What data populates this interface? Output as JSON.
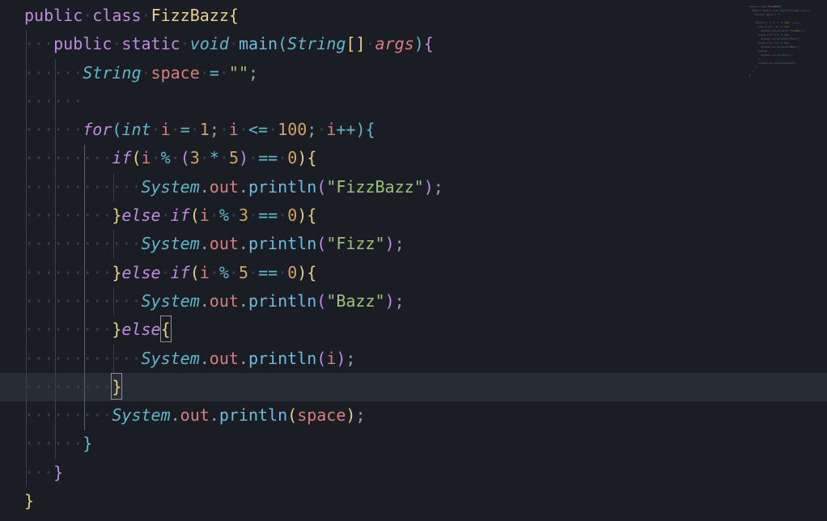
{
  "language": "java",
  "colors": {
    "background": "#1a1d23",
    "current_line": "#282c34",
    "keyword": "#c08be0",
    "type": "#5fb7c9",
    "class": "#e6cf8b",
    "function": "#6fbcde",
    "variable": "#d97e7e",
    "number": "#d0a36a",
    "string": "#9bc47a",
    "operator": "#5fb7c9",
    "punct": "#9aa0ac",
    "whitespace_marker": "#3b3f48"
  },
  "editor": {
    "cursor_line_index": 13,
    "lines": [
      {
        "indent": 0,
        "tokens": [
          {
            "t": "public",
            "c": "kw"
          },
          {
            "t": " ",
            "c": "ws"
          },
          {
            "t": "class",
            "c": "kw"
          },
          {
            "t": " ",
            "c": "ws"
          },
          {
            "t": "FizzBazz",
            "c": "cls"
          },
          {
            "t": "{",
            "c": "brace1"
          }
        ]
      },
      {
        "indent": 1,
        "tokens": [
          {
            "t": "public",
            "c": "kw"
          },
          {
            "t": " ",
            "c": "ws"
          },
          {
            "t": "static",
            "c": "kw"
          },
          {
            "t": " ",
            "c": "ws"
          },
          {
            "t": "void",
            "c": "type"
          },
          {
            "t": " ",
            "c": "ws"
          },
          {
            "t": "main",
            "c": "fn"
          },
          {
            "t": "(",
            "c": "brace3"
          },
          {
            "t": "String",
            "c": "type"
          },
          {
            "t": "[]",
            "c": "brk"
          },
          {
            "t": " ",
            "c": "ws"
          },
          {
            "t": "args",
            "c": "varit"
          },
          {
            "t": ")",
            "c": "brace3"
          },
          {
            "t": "{",
            "c": "brace2"
          }
        ]
      },
      {
        "indent": 2,
        "tokens": [
          {
            "t": "String",
            "c": "type"
          },
          {
            "t": " ",
            "c": "ws"
          },
          {
            "t": "space",
            "c": "var"
          },
          {
            "t": " ",
            "c": "ws"
          },
          {
            "t": "=",
            "c": "op"
          },
          {
            "t": " ",
            "c": "ws"
          },
          {
            "t": "\"\"",
            "c": "str"
          },
          {
            "t": ";",
            "c": "pun"
          }
        ]
      },
      {
        "indent": 2,
        "tokens": []
      },
      {
        "indent": 2,
        "tokens": [
          {
            "t": "for",
            "c": "kw2"
          },
          {
            "t": "(",
            "c": "brace3"
          },
          {
            "t": "int",
            "c": "type"
          },
          {
            "t": " ",
            "c": "ws"
          },
          {
            "t": "i",
            "c": "var"
          },
          {
            "t": " ",
            "c": "ws"
          },
          {
            "t": "=",
            "c": "op"
          },
          {
            "t": " ",
            "c": "ws"
          },
          {
            "t": "1",
            "c": "num"
          },
          {
            "t": ";",
            "c": "pun"
          },
          {
            "t": " ",
            "c": "ws"
          },
          {
            "t": "i",
            "c": "var"
          },
          {
            "t": " ",
            "c": "ws"
          },
          {
            "t": "<=",
            "c": "op"
          },
          {
            "t": " ",
            "c": "ws"
          },
          {
            "t": "100",
            "c": "num"
          },
          {
            "t": ";",
            "c": "pun"
          },
          {
            "t": " ",
            "c": "ws"
          },
          {
            "t": "i",
            "c": "var"
          },
          {
            "t": "++",
            "c": "op"
          },
          {
            "t": ")",
            "c": "brace3"
          },
          {
            "t": "{",
            "c": "brace3"
          }
        ]
      },
      {
        "indent": 3,
        "tokens": [
          {
            "t": "if",
            "c": "kw2"
          },
          {
            "t": "(",
            "c": "brace4"
          },
          {
            "t": "i",
            "c": "var"
          },
          {
            "t": " ",
            "c": "ws"
          },
          {
            "t": "%",
            "c": "op"
          },
          {
            "t": " ",
            "c": "ws"
          },
          {
            "t": "(",
            "c": "brace5"
          },
          {
            "t": "3",
            "c": "num"
          },
          {
            "t": " ",
            "c": "ws"
          },
          {
            "t": "*",
            "c": "op"
          },
          {
            "t": " ",
            "c": "ws"
          },
          {
            "t": "5",
            "c": "num"
          },
          {
            "t": ")",
            "c": "brace5"
          },
          {
            "t": " ",
            "c": "ws"
          },
          {
            "t": "==",
            "c": "op"
          },
          {
            "t": " ",
            "c": "ws"
          },
          {
            "t": "0",
            "c": "num"
          },
          {
            "t": ")",
            "c": "brace4"
          },
          {
            "t": "{",
            "c": "brace4"
          }
        ]
      },
      {
        "indent": 4,
        "tokens": [
          {
            "t": "System",
            "c": "type"
          },
          {
            "t": ".",
            "c": "pun"
          },
          {
            "t": "out",
            "c": "var"
          },
          {
            "t": ".",
            "c": "pun"
          },
          {
            "t": "println",
            "c": "fn"
          },
          {
            "t": "(",
            "c": "brace5"
          },
          {
            "t": "\"FizzBazz\"",
            "c": "str"
          },
          {
            "t": ")",
            "c": "brace5"
          },
          {
            "t": ";",
            "c": "pun"
          }
        ]
      },
      {
        "indent": 3,
        "tokens": [
          {
            "t": "}",
            "c": "brace4"
          },
          {
            "t": "else",
            "c": "kw2"
          },
          {
            "t": " ",
            "c": "ws"
          },
          {
            "t": "if",
            "c": "kw2"
          },
          {
            "t": "(",
            "c": "brace4"
          },
          {
            "t": "i",
            "c": "var"
          },
          {
            "t": " ",
            "c": "ws"
          },
          {
            "t": "%",
            "c": "op"
          },
          {
            "t": " ",
            "c": "ws"
          },
          {
            "t": "3",
            "c": "num"
          },
          {
            "t": " ",
            "c": "ws"
          },
          {
            "t": "==",
            "c": "op"
          },
          {
            "t": " ",
            "c": "ws"
          },
          {
            "t": "0",
            "c": "num"
          },
          {
            "t": ")",
            "c": "brace4"
          },
          {
            "t": "{",
            "c": "brace4"
          }
        ]
      },
      {
        "indent": 4,
        "tokens": [
          {
            "t": "System",
            "c": "type"
          },
          {
            "t": ".",
            "c": "pun"
          },
          {
            "t": "out",
            "c": "var"
          },
          {
            "t": ".",
            "c": "pun"
          },
          {
            "t": "println",
            "c": "fn"
          },
          {
            "t": "(",
            "c": "brace5"
          },
          {
            "t": "\"Fizz\"",
            "c": "str"
          },
          {
            "t": ")",
            "c": "brace5"
          },
          {
            "t": ";",
            "c": "pun"
          }
        ]
      },
      {
        "indent": 3,
        "tokens": [
          {
            "t": "}",
            "c": "brace4"
          },
          {
            "t": "else",
            "c": "kw2"
          },
          {
            "t": " ",
            "c": "ws"
          },
          {
            "t": "if",
            "c": "kw2"
          },
          {
            "t": "(",
            "c": "brace4"
          },
          {
            "t": "i",
            "c": "var"
          },
          {
            "t": " ",
            "c": "ws"
          },
          {
            "t": "%",
            "c": "op"
          },
          {
            "t": " ",
            "c": "ws"
          },
          {
            "t": "5",
            "c": "num"
          },
          {
            "t": " ",
            "c": "ws"
          },
          {
            "t": "==",
            "c": "op"
          },
          {
            "t": " ",
            "c": "ws"
          },
          {
            "t": "0",
            "c": "num"
          },
          {
            "t": ")",
            "c": "brace4"
          },
          {
            "t": "{",
            "c": "brace4"
          }
        ]
      },
      {
        "indent": 4,
        "tokens": [
          {
            "t": "System",
            "c": "type"
          },
          {
            "t": ".",
            "c": "pun"
          },
          {
            "t": "out",
            "c": "var"
          },
          {
            "t": ".",
            "c": "pun"
          },
          {
            "t": "println",
            "c": "fn"
          },
          {
            "t": "(",
            "c": "brace5"
          },
          {
            "t": "\"Bazz\"",
            "c": "str"
          },
          {
            "t": ")",
            "c": "brace5"
          },
          {
            "t": ";",
            "c": "pun"
          }
        ]
      },
      {
        "indent": 3,
        "tokens": [
          {
            "t": "}",
            "c": "brace4"
          },
          {
            "t": "else",
            "c": "kw2"
          },
          {
            "t": "{",
            "c": "brace4",
            "box": true
          }
        ]
      },
      {
        "indent": 4,
        "tokens": [
          {
            "t": "System",
            "c": "type"
          },
          {
            "t": ".",
            "c": "pun"
          },
          {
            "t": "out",
            "c": "var"
          },
          {
            "t": ".",
            "c": "pun"
          },
          {
            "t": "println",
            "c": "fn"
          },
          {
            "t": "(",
            "c": "brace5"
          },
          {
            "t": "i",
            "c": "var"
          },
          {
            "t": ")",
            "c": "brace5"
          },
          {
            "t": ";",
            "c": "pun"
          }
        ]
      },
      {
        "indent": 3,
        "tokens": [
          {
            "t": "}",
            "c": "brace4",
            "box": true
          }
        ]
      },
      {
        "indent": 3,
        "tokens": [
          {
            "t": "System",
            "c": "type"
          },
          {
            "t": ".",
            "c": "pun"
          },
          {
            "t": "out",
            "c": "var"
          },
          {
            "t": ".",
            "c": "pun"
          },
          {
            "t": "println",
            "c": "fn"
          },
          {
            "t": "(",
            "c": "brace4"
          },
          {
            "t": "space",
            "c": "var"
          },
          {
            "t": ")",
            "c": "brace4"
          },
          {
            "t": ";",
            "c": "pun"
          }
        ]
      },
      {
        "indent": 2,
        "tokens": [
          {
            "t": "}",
            "c": "brace3"
          }
        ]
      },
      {
        "indent": 1,
        "tokens": [
          {
            "t": "}",
            "c": "brace2"
          }
        ]
      },
      {
        "indent": 0,
        "tokens": [
          {
            "t": "}",
            "c": "brace1"
          }
        ]
      }
    ],
    "guides": [
      {
        "col": 1,
        "from": 1,
        "to": 16
      },
      {
        "col": 2,
        "from": 2,
        "to": 15
      },
      {
        "col": 3,
        "from": 5,
        "to": 14,
        "active": true
      },
      {
        "col": 4,
        "from": 6,
        "to": 6
      },
      {
        "col": 4,
        "from": 8,
        "to": 8
      },
      {
        "col": 4,
        "from": 10,
        "to": 10
      },
      {
        "col": 4,
        "from": 12,
        "to": 12
      }
    ]
  }
}
